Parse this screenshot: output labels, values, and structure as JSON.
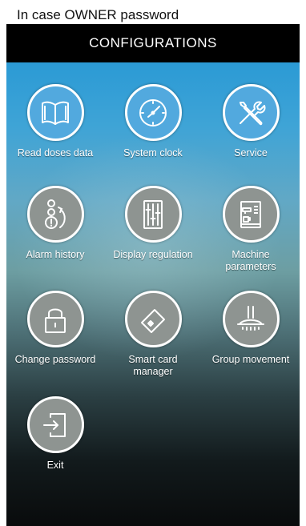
{
  "caption": "In case OWNER password",
  "screen_title": "CONFIGURATIONS",
  "tiles": [
    {
      "label": "Read doses data",
      "icon": "book-icon"
    },
    {
      "label": "System clock",
      "icon": "clock-icon"
    },
    {
      "label": "Service",
      "icon": "tools-icon"
    },
    {
      "label": "Alarm history",
      "icon": "alarm-history-icon"
    },
    {
      "label": "Display regulation",
      "icon": "sliders-icon"
    },
    {
      "label": "Machine\nparameters",
      "icon": "coffee-machine-icon"
    },
    {
      "label": "Change password",
      "icon": "padlock-icon"
    },
    {
      "label": "Smart card\nmanager",
      "icon": "smart-card-icon"
    },
    {
      "label": "Group movement",
      "icon": "group-head-icon"
    },
    {
      "label": "Exit",
      "icon": "exit-icon"
    }
  ]
}
